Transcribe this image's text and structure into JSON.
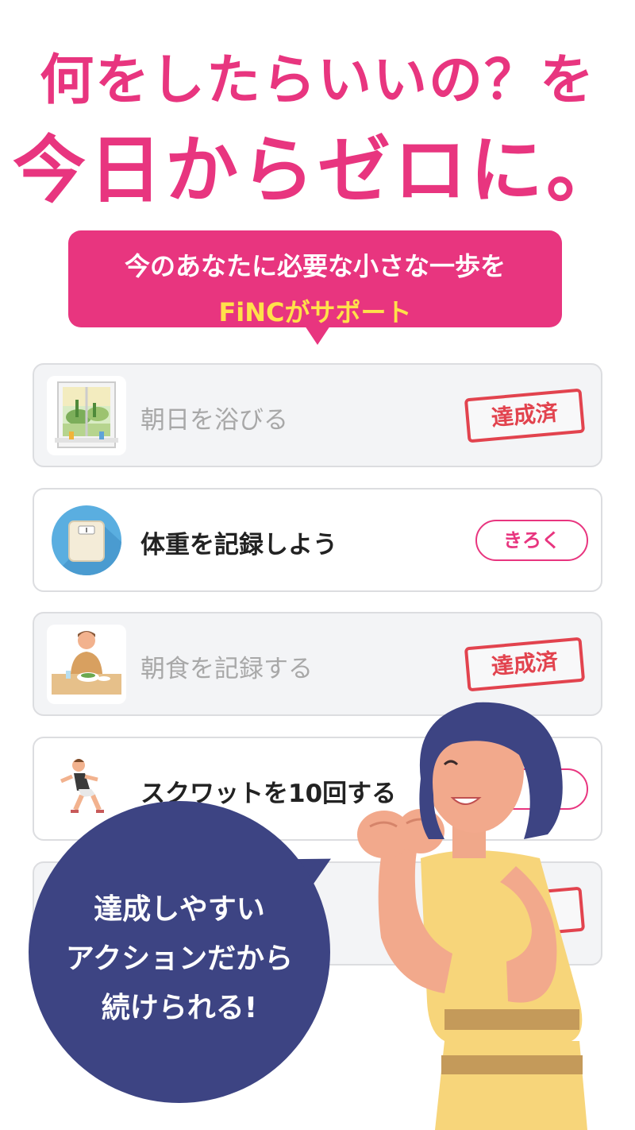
{
  "headline": {
    "line1": "何をしたらいいの？を",
    "line2": "今日からゼロに。"
  },
  "intro_bubble": {
    "line1": "今のあなたに必要な小さな一歩を",
    "line2": "FiNCがサポート"
  },
  "tasks": [
    {
      "label": "朝日を浴びる",
      "status": "達成済",
      "icon": "sunrise-window-icon",
      "done": true
    },
    {
      "label": "体重を記録しよう",
      "action": "きろく",
      "icon": "weight-scale-icon",
      "done": false
    },
    {
      "label": "朝食を記録する",
      "status": "達成済",
      "icon": "breakfast-icon",
      "done": true
    },
    {
      "label": "スクワットを10回する",
      "action": "",
      "icon": "squat-icon",
      "done": false
    },
    {
      "label": "",
      "status": "",
      "icon": "",
      "done": true
    }
  ],
  "speech": {
    "line1": "達成しやすい",
    "line2": "アクションだから",
    "line3": "続けられる!"
  },
  "colors": {
    "accent": "#e8357f",
    "highlight": "#ffe14a",
    "stamp": "#e2434e",
    "speech_bg": "#3d4483"
  }
}
